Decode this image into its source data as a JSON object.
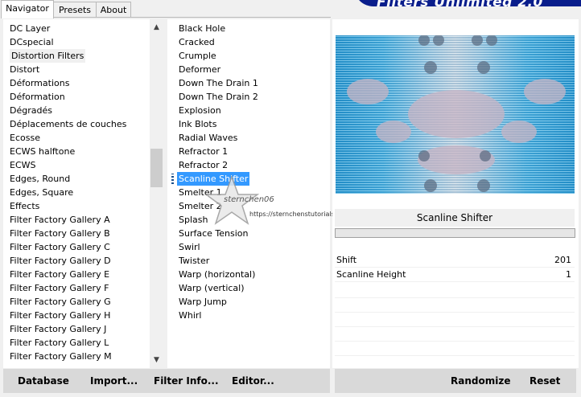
{
  "tabs": [
    "Navigator",
    "Presets",
    "About"
  ],
  "banner_title": "Filters Unlimited 2.0",
  "categories": [
    "DC Layer",
    "DCspecial",
    "Distortion Filters",
    "Distort",
    "Déformations",
    "Déformation",
    "Dégradés",
    "Déplacements de couches",
    "Ecosse",
    "ECWS halftone",
    "ECWS",
    "Edges, Round",
    "Edges, Square",
    "Effects",
    "Filter Factory Gallery A",
    "Filter Factory Gallery B",
    "Filter Factory Gallery C",
    "Filter Factory Gallery D",
    "Filter Factory Gallery E",
    "Filter Factory Gallery F",
    "Filter Factory Gallery G",
    "Filter Factory Gallery H",
    "Filter Factory Gallery J",
    "Filter Factory Gallery L",
    "Filter Factory Gallery M"
  ],
  "selected_category": "Distortion Filters",
  "filters": [
    "Black Hole",
    "Cracked",
    "Crumple",
    "Deformer",
    "Down The Drain 1",
    "Down The Drain 2",
    "Explosion",
    "Ink Blots",
    "Radial Waves",
    "Refractor 1",
    "Refractor 2",
    "Scanline Shifter",
    "Smelter 1",
    "Smelter 2",
    "Splash",
    "Surface Tension",
    "Swirl",
    "Twister",
    "Warp (horizontal)",
    "Warp (vertical)",
    "Warp Jump",
    "Whirl"
  ],
  "selected_filter": "Scanline Shifter",
  "watermark": {
    "name": "sternchen06",
    "url": "https://sternchenstutorialstuebchen.de/"
  },
  "filter_name": "Scanline Shifter",
  "parameters": [
    {
      "name": "Shift",
      "value": "201"
    },
    {
      "name": "Scanline Height",
      "value": "1"
    }
  ],
  "buttons": {
    "database": "Database",
    "import": "Import...",
    "filter_info": "Filter Info...",
    "editor": "Editor...",
    "randomize": "Randomize",
    "reset": "Reset"
  },
  "colors": {
    "selection": "#3399ff",
    "banner": "#1428a0",
    "preview_blue": "#2a9fd8"
  },
  "icons": {
    "scroll_up": "▲",
    "scroll_down": "▼"
  }
}
